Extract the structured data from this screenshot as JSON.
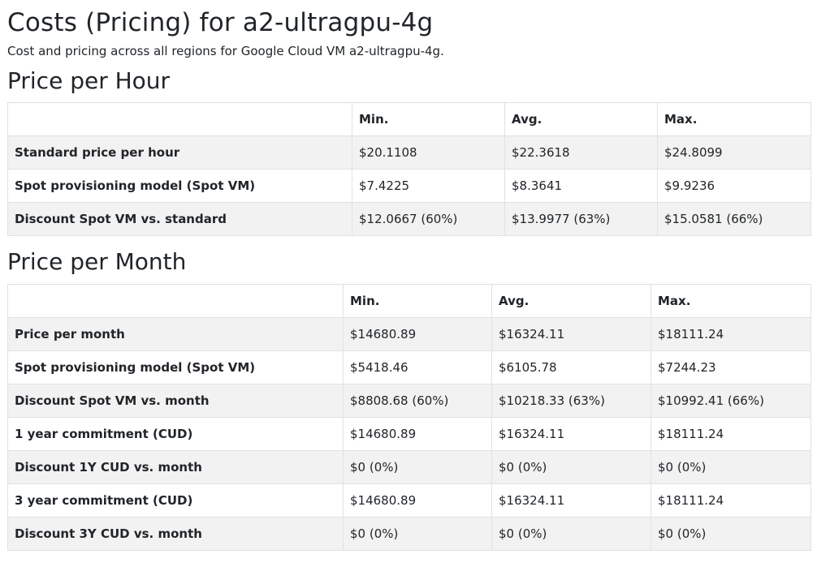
{
  "page": {
    "title": "Costs (Pricing) for a2-ultragpu-4g",
    "subtitle": "Cost and pricing across all regions for Google Cloud VM a2-ultragpu-4g."
  },
  "hour": {
    "heading": "Price per Hour",
    "columns": [
      "",
      "Min.",
      "Avg.",
      "Max."
    ],
    "rows": [
      {
        "label": "Standard price per hour",
        "min": "$20.1108",
        "avg": "$22.3618",
        "max": "$24.8099"
      },
      {
        "label": "Spot provisioning model (Spot VM)",
        "min": "$7.4225",
        "avg": "$8.3641",
        "max": "$9.9236"
      },
      {
        "label": "Discount Spot VM vs. standard",
        "min": "$12.0667 (60%)",
        "avg": "$13.9977 (63%)",
        "max": "$15.0581 (66%)"
      }
    ]
  },
  "month": {
    "heading": "Price per Month",
    "columns": [
      "",
      "Min.",
      "Avg.",
      "Max."
    ],
    "rows": [
      {
        "label": "Price per month",
        "min": "$14680.89",
        "avg": "$16324.11",
        "max": "$18111.24"
      },
      {
        "label": "Spot provisioning model (Spot VM)",
        "min": "$5418.46",
        "avg": "$6105.78",
        "max": "$7244.23"
      },
      {
        "label": "Discount Spot VM vs. month",
        "min": "$8808.68 (60%)",
        "avg": "$10218.33 (63%)",
        "max": "$10992.41 (66%)"
      },
      {
        "label": "1 year commitment (CUD)",
        "min": "$14680.89",
        "avg": "$16324.11",
        "max": "$18111.24"
      },
      {
        "label": "Discount 1Y CUD vs. month",
        "min": "$0 (0%)",
        "avg": "$0 (0%)",
        "max": "$0 (0%)"
      },
      {
        "label": "3 year commitment (CUD)",
        "min": "$14680.89",
        "avg": "$16324.11",
        "max": "$18111.24"
      },
      {
        "label": "Discount 3Y CUD vs. month",
        "min": "$0 (0%)",
        "avg": "$0 (0%)",
        "max": "$0 (0%)"
      }
    ]
  }
}
